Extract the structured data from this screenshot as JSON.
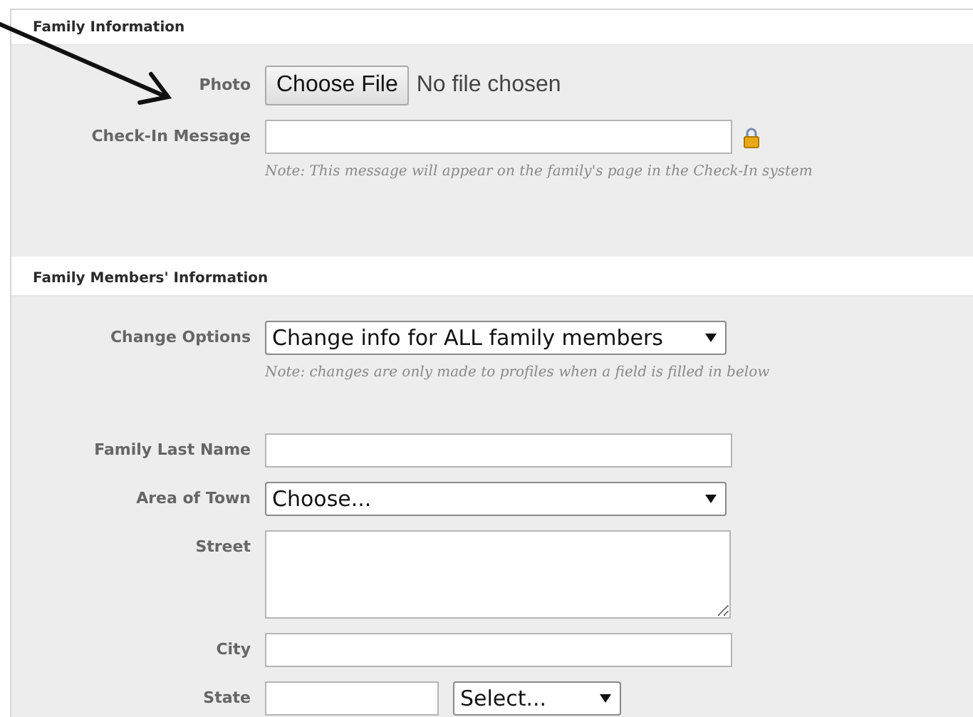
{
  "sections": [
    {
      "title": "Family Information",
      "fields": [
        {
          "kind": "file",
          "label": "Photo",
          "button": "Choose File",
          "status": "No file chosen"
        },
        {
          "kind": "text",
          "label": "Check-In Message",
          "locked": true,
          "note": "Note: This message will appear on the family's page in the Check-In system"
        }
      ]
    },
    {
      "title": "Family Members' Information",
      "fields": [
        {
          "kind": "select",
          "label": "Change Options",
          "value": "Change info for ALL family members",
          "note": "Note: changes are only made to profiles when a field is filled in below"
        },
        {
          "kind": "text",
          "label": "Family Last Name",
          "locked": false
        },
        {
          "kind": "select",
          "label": "Area of Town",
          "value": "Choose..."
        },
        {
          "kind": "textarea",
          "label": "Street"
        },
        {
          "kind": "text",
          "label": "City",
          "locked": false
        },
        {
          "kind": "state",
          "label": "State",
          "value": "Select..."
        }
      ]
    }
  ]
}
